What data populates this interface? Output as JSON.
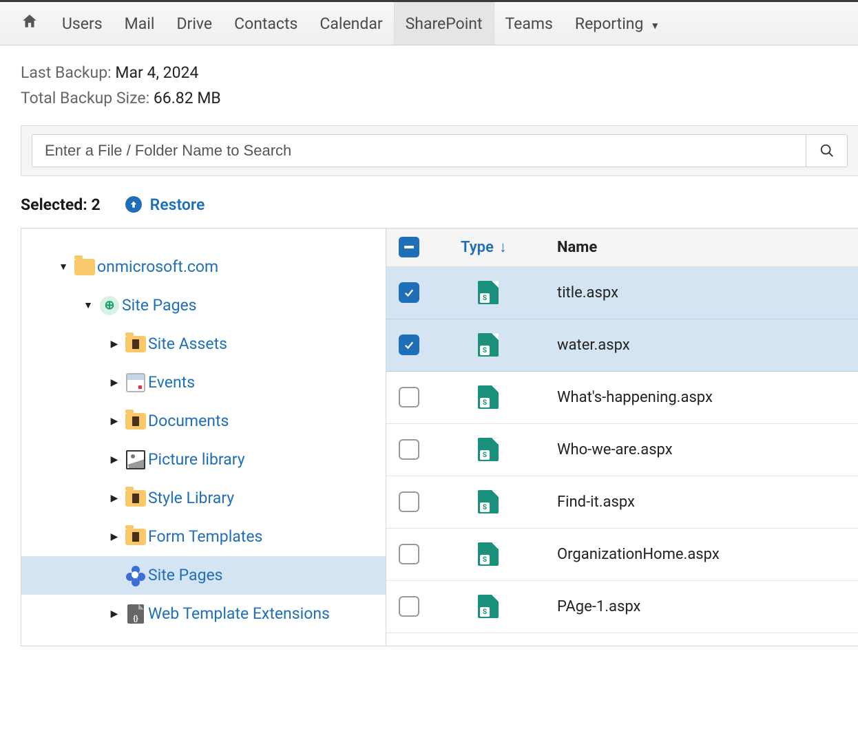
{
  "nav": {
    "items": [
      "Users",
      "Mail",
      "Drive",
      "Contacts",
      "Calendar",
      "SharePoint",
      "Teams",
      "Reporting"
    ],
    "active": "SharePoint"
  },
  "info": {
    "last_backup_label": "Last Backup:",
    "last_backup_value": "Mar 4, 2024",
    "total_size_label": "Total Backup Size:",
    "total_size_value": "66.82 MB"
  },
  "search": {
    "placeholder": "Enter a File / Folder Name to Search"
  },
  "selection": {
    "label_prefix": "Selected:",
    "count": "2",
    "restore_label": "Restore"
  },
  "tree": {
    "root": {
      "label": "onmicrosoft.com"
    },
    "site": {
      "label": "Site Pages"
    },
    "children": [
      {
        "label": "Site Assets",
        "icon": "folder-lib",
        "expandable": true
      },
      {
        "label": "Events",
        "icon": "calendar",
        "expandable": true
      },
      {
        "label": "Documents",
        "icon": "folder-lib",
        "expandable": true
      },
      {
        "label": "Picture library",
        "icon": "picture",
        "expandable": true
      },
      {
        "label": "Style Library",
        "icon": "folder-lib",
        "expandable": true
      },
      {
        "label": "Form Templates",
        "icon": "folder-lib",
        "expandable": true
      },
      {
        "label": "Site Pages",
        "icon": "flower",
        "expandable": false,
        "active": true
      },
      {
        "label": "Web Template Extensions",
        "icon": "code",
        "expandable": true
      }
    ]
  },
  "list": {
    "columns": {
      "type": "Type",
      "name": "Name",
      "sort_dir": "down"
    },
    "rows": [
      {
        "name": "title.aspx",
        "selected": true
      },
      {
        "name": "water.aspx",
        "selected": true
      },
      {
        "name": "What's-happening.aspx",
        "selected": false
      },
      {
        "name": "Who-we-are.aspx",
        "selected": false
      },
      {
        "name": "Find-it.aspx",
        "selected": false
      },
      {
        "name": "OrganizationHome.aspx",
        "selected": false
      },
      {
        "name": "PAge-1.aspx",
        "selected": false
      }
    ]
  }
}
